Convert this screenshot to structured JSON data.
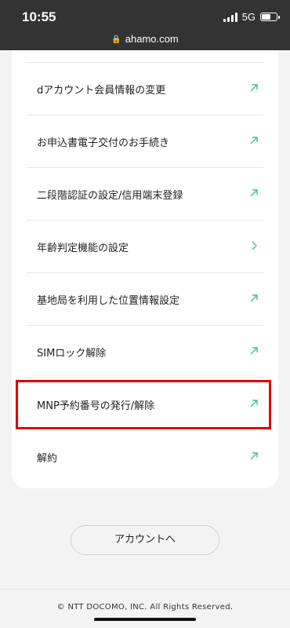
{
  "status_bar": {
    "time": "10:55",
    "network": "5G"
  },
  "browser": {
    "url": "ahamo.com"
  },
  "menu": {
    "items": [
      {
        "label": "dアカウント会員情報の変更",
        "icon": "external-arrow-icon"
      },
      {
        "label": "お申込書電子交付のお手続き",
        "icon": "external-arrow-icon"
      },
      {
        "label": "二段階認証の設定/信用端末登録",
        "icon": "external-arrow-icon"
      },
      {
        "label": "年齢判定機能の設定",
        "icon": "chevron-right-icon"
      },
      {
        "label": "基地局を利用した位置情報設定",
        "icon": "external-arrow-icon"
      },
      {
        "label": "SIMロック解除",
        "icon": "external-arrow-icon"
      },
      {
        "label": "MNP予約番号の発行/解除",
        "icon": "external-arrow-icon"
      },
      {
        "label": "解約",
        "icon": "external-arrow-icon"
      }
    ]
  },
  "account_button": {
    "label": "アカウントへ"
  },
  "footer": {
    "copyright": "© NTT DOCOMO, INC. All Rights Reserved."
  },
  "colors": {
    "accent": "#3dbf9a",
    "highlight": "#e00000",
    "status_bar": "#333333"
  }
}
